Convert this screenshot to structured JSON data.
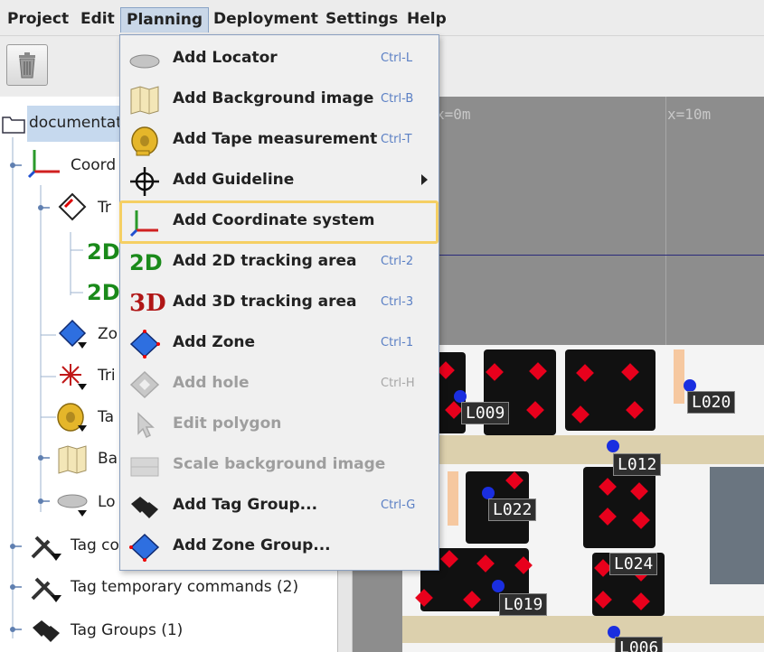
{
  "menubar": {
    "items": [
      {
        "label": "Project"
      },
      {
        "label": "Edit"
      },
      {
        "label": "Planning"
      },
      {
        "label": "Deployment"
      },
      {
        "label": "Settings"
      },
      {
        "label": "Help"
      }
    ]
  },
  "toolbar": {
    "delete_icon": "trash-icon"
  },
  "tree": {
    "root_label": "documentat",
    "rows": [
      {
        "label": "Coord"
      },
      {
        "label": "Tr"
      },
      {
        "label": "2D"
      },
      {
        "label": "2D"
      },
      {
        "label": "Zo"
      },
      {
        "label": "Tri"
      },
      {
        "label": "Ta"
      },
      {
        "label": "Ba"
      },
      {
        "label": "Lo"
      },
      {
        "label": "Tag co"
      },
      {
        "label": "Tag temporary commands (2)"
      },
      {
        "label": "Tag Groups (1)"
      }
    ]
  },
  "canvas": {
    "ruler_labels": [
      "x=0m",
      "x=10m"
    ],
    "locators": [
      "L009",
      "L020",
      "L012",
      "L022",
      "L024",
      "L019",
      "L006"
    ]
  },
  "planning_menu": {
    "items": [
      {
        "label": "Add Locator",
        "shortcut": "Ctrl-L",
        "enabled": true,
        "icon": "locator-icon"
      },
      {
        "label": "Add Background image",
        "shortcut": "Ctrl-B",
        "enabled": true,
        "icon": "map-icon"
      },
      {
        "label": "Add Tape measurement",
        "shortcut": "Ctrl-T",
        "enabled": true,
        "icon": "tape-measure-icon"
      },
      {
        "label": "Add Guideline",
        "shortcut": "",
        "enabled": true,
        "icon": "guideline-icon",
        "submenu": true
      },
      {
        "label": "Add Coordinate system",
        "shortcut": "",
        "enabled": true,
        "icon": "coordinate-axes-icon",
        "highlighted": true
      },
      {
        "label": "Add 2D tracking area",
        "shortcut": "Ctrl-2",
        "enabled": true,
        "icon": "2d-icon",
        "icon_text": "2D"
      },
      {
        "label": "Add 3D tracking area",
        "shortcut": "Ctrl-3",
        "enabled": true,
        "icon": "3d-icon",
        "icon_text": "3D"
      },
      {
        "label": "Add Zone",
        "shortcut": "Ctrl-1",
        "enabled": true,
        "icon": "zone-icon"
      },
      {
        "label": "Add hole",
        "shortcut": "Ctrl-H",
        "enabled": false,
        "icon": "hole-icon"
      },
      {
        "label": "Edit polygon",
        "shortcut": "",
        "enabled": false,
        "icon": "edit-polygon-icon"
      },
      {
        "label": "Scale background image",
        "shortcut": "",
        "enabled": false,
        "icon": "scale-image-icon"
      },
      {
        "label": "Add Tag Group...",
        "shortcut": "Ctrl-G",
        "enabled": true,
        "icon": "tag-group-icon"
      },
      {
        "label": "Add Zone Group...",
        "shortcut": "",
        "enabled": true,
        "icon": "zone-group-icon"
      }
    ]
  }
}
